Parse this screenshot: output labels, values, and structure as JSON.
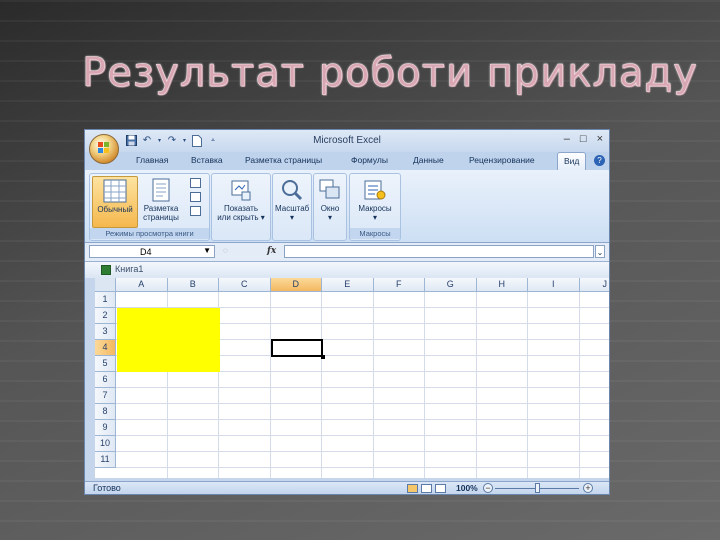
{
  "slide": {
    "title": "Результат роботи прикладу"
  },
  "window": {
    "title": "Microsoft Excel",
    "controls": [
      "–",
      "□",
      "×"
    ]
  },
  "ribbon": {
    "tabs": [
      "Главная",
      "Вставка",
      "Разметка страницы",
      "Формулы",
      "Данные",
      "Рецензирование",
      "Вид"
    ],
    "active_tab": "Вид",
    "groups": {
      "views": {
        "label": "Режимы просмотра книги",
        "normal": "Обычный",
        "page_layout_1": "Разметка",
        "page_layout_2": "страницы"
      },
      "show": {
        "label_1": "Показать",
        "label_2": "или скрыть"
      },
      "zoom": {
        "label": "Масштаб"
      },
      "window": {
        "label": "Окно"
      },
      "macros": {
        "button": "Макросы",
        "label": "Макросы"
      }
    }
  },
  "formula_bar": {
    "name_box": "D4",
    "fx": "fx",
    "value": ""
  },
  "workbook": {
    "name": "Книга1",
    "columns": [
      "A",
      "B",
      "C",
      "D",
      "E",
      "F",
      "G",
      "H",
      "I",
      "J"
    ],
    "rows": [
      "1",
      "2",
      "3",
      "4",
      "5",
      "6",
      "7",
      "8",
      "9",
      "10",
      "11"
    ],
    "selected_cell": "D4",
    "highlight_range": "A2:B5",
    "highlight_color": "#ffff00"
  },
  "status_bar": {
    "ready": "Готово",
    "zoom": "100%",
    "zoom_level_percent": 100
  },
  "colors": {
    "accent": "#f4b860",
    "ribbon": "#cddff4",
    "title": "#d9a7b3"
  }
}
